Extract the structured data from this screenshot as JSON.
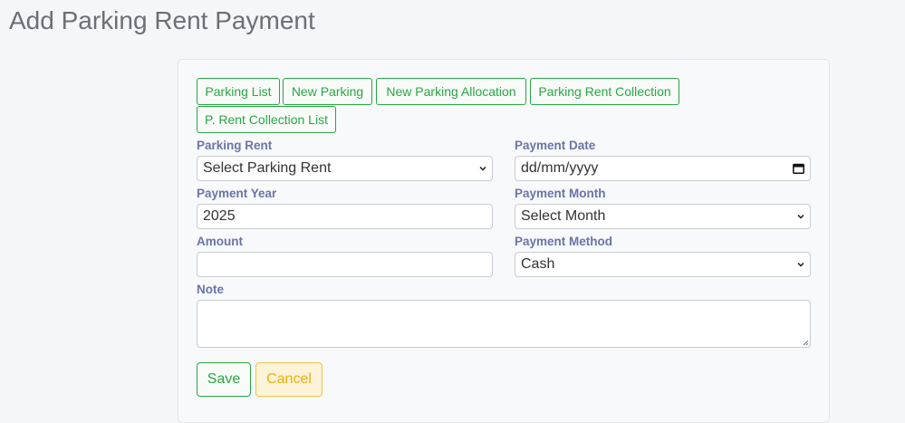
{
  "page": {
    "title": "Add Parking Rent Payment"
  },
  "nav": {
    "buttons": [
      {
        "label": "Parking List"
      },
      {
        "label": "New Parking"
      },
      {
        "label": "New Parking Allocation"
      },
      {
        "label": "Parking Rent Collection"
      },
      {
        "label": "P. Rent Collection List"
      }
    ]
  },
  "form": {
    "parking_rent": {
      "label": "Parking Rent",
      "value": "Select Parking Rent"
    },
    "payment_date": {
      "label": "Payment Date",
      "placeholder": "dd/mm/yyyy"
    },
    "payment_year": {
      "label": "Payment Year",
      "value": "2025"
    },
    "payment_month": {
      "label": "Payment Month",
      "value": "Select Month"
    },
    "amount": {
      "label": "Amount",
      "value": ""
    },
    "payment_method": {
      "label": "Payment Method",
      "value": "Cash"
    },
    "note": {
      "label": "Note",
      "value": ""
    }
  },
  "actions": {
    "save_label": "Save",
    "cancel_label": "Cancel"
  },
  "colors": {
    "success": "#28a745",
    "warning": "#ffc107",
    "label": "#6a74a8"
  }
}
